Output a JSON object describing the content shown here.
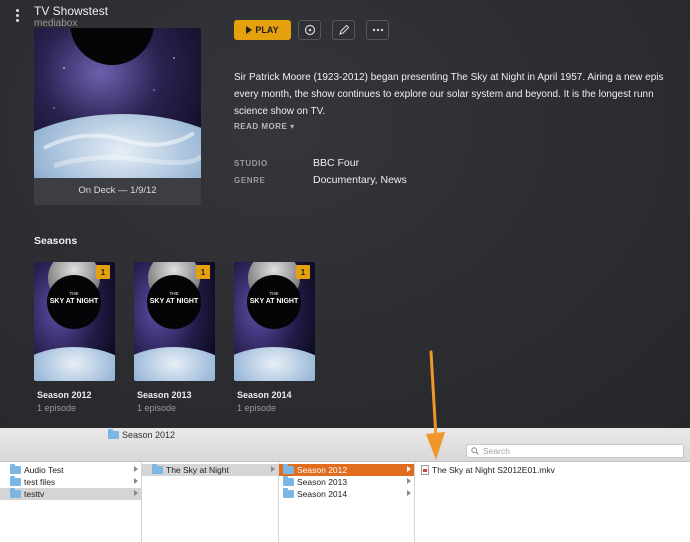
{
  "header": {
    "title": "TV Showstest",
    "subtitle": "mediabox"
  },
  "poster": {
    "on_deck": "On Deck — 1/9/12"
  },
  "actions": {
    "play_label": "PLAY"
  },
  "summary": {
    "lines": [
      "Sir Patrick Moore (1923-2012) began presenting The Sky at Night in April 1957. Airing a new epis",
      "every month, the show continues to explore our solar system and beyond. It is the longest runn",
      "science show on TV."
    ],
    "read_more": "READ MORE ▾"
  },
  "meta": {
    "studio_label": "STUDIO",
    "studio_value": "BBC Four",
    "genre_label": "GENRE",
    "genre_value": "Documentary, News"
  },
  "seasons": {
    "heading": "Seasons",
    "items": [
      {
        "name": "Season 2012",
        "episodes": "1 episode",
        "badge": "1",
        "art_line1": "THE",
        "art_line2": "SKY AT NIGHT"
      },
      {
        "name": "Season 2013",
        "episodes": "1 episode",
        "badge": "1",
        "art_line1": "THE",
        "art_line2": "SKY AT NIGHT"
      },
      {
        "name": "Season 2014",
        "episodes": "1 episode",
        "badge": "1",
        "art_line1": "THE",
        "art_line2": "SKY AT NIGHT"
      }
    ]
  },
  "finder": {
    "path_label": "Season 2012",
    "search_placeholder": "Search",
    "col1": [
      "Audio Test",
      "test files",
      "testtv"
    ],
    "col2": [
      "The Sky at Night"
    ],
    "col3": [
      "Season 2012",
      "Season 2013",
      "Season 2014"
    ],
    "col4": [
      "The Sky at Night S2012E01.mkv"
    ]
  },
  "colors": {
    "accent": "#e5a00d",
    "finder_selection": "#df6d1d",
    "annotation_arrow": "#f0962a"
  }
}
